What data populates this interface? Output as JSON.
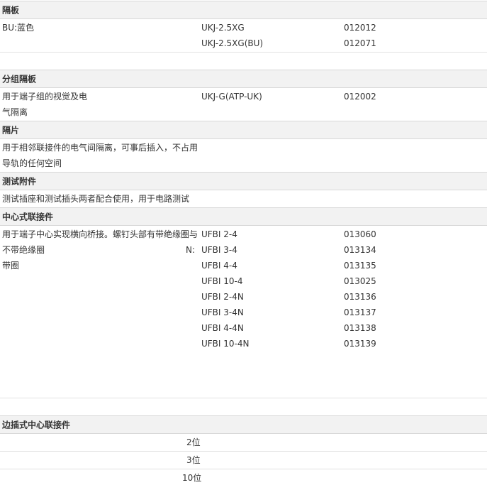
{
  "sections": {
    "s1": {
      "title": "隔板",
      "desc": "BU:蓝色",
      "rows": [
        {
          "model": "UKJ-2.5XG",
          "code": "012012"
        },
        {
          "model": "UKJ-2.5XG(BU)",
          "code": "012071"
        }
      ]
    },
    "s2": {
      "title": "分组隔板",
      "desc_lines": [
        "用于端子组的视觉及电",
        "气隔离"
      ],
      "rows": [
        {
          "model": "UKJ-G(ATP-UK)",
          "code": "012002"
        }
      ]
    },
    "s3": {
      "title": "隔片",
      "desc_lines": [
        "用于相邻联接件的电气间隔离，可事后插入，不占用",
        "导轨的任何空间"
      ]
    },
    "s4": {
      "title": "测试附件",
      "desc": "测试插座和测试插头两者配合使用，用于电路测试"
    },
    "s5": {
      "title": "中心式联接件",
      "desc_lines": [
        "用于端子中心实现横向桥接。螺钉头部有带绝缘圈与",
        "不带绝缘圈",
        "带圈"
      ],
      "marker": "N:",
      "rows": [
        {
          "model": "UFBI 2-4",
          "code": "013060"
        },
        {
          "model": "UFBI 3-4",
          "code": "013134"
        },
        {
          "model": "UFBI 4-4",
          "code": "013135"
        },
        {
          "model": "UFBI 10-4",
          "code": "013025"
        },
        {
          "model": "UFBI 2-4N",
          "code": "013136"
        },
        {
          "model": "UFBI 3-4N",
          "code": "013137"
        },
        {
          "model": "UFBI 4-4N",
          "code": "013138"
        },
        {
          "model": "UFBI 10-4N",
          "code": "013139"
        }
      ]
    },
    "s6": {
      "title": "边插式中心联接件",
      "positions": [
        "2位",
        "3位",
        "10位"
      ]
    }
  }
}
